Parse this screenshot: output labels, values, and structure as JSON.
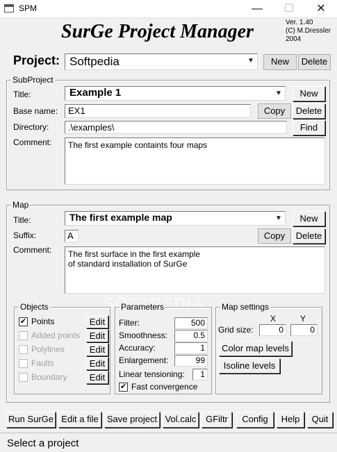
{
  "window": {
    "title": "SPM",
    "minimize": "—",
    "maximize": "☐",
    "close": "✕"
  },
  "header": {
    "app_title": "SurGe Project Manager",
    "version_lines": [
      "Ver. 1.40",
      "(C) M.Dressler",
      "2004"
    ]
  },
  "project": {
    "label": "Project:",
    "value": "Softpedia",
    "new_label": "New",
    "delete_label": "Delete"
  },
  "subproject": {
    "group_title": "SubProject",
    "title_label": "Title:",
    "title_value": "Example 1",
    "base_name_label": "Base name:",
    "base_name_value": "EX1",
    "directory_label": "Directory:",
    "directory_value": ".\\examples\\",
    "comment_label": "Comment:",
    "comment_value": "The first example containts four maps",
    "new_label": "New",
    "copy_label": "Copy",
    "delete_label": "Delete",
    "find_label": "Find"
  },
  "map": {
    "group_title": "Map",
    "title_label": "Title:",
    "title_value": "The first example map",
    "suffix_label": "Suffix:",
    "suffix_value": "A",
    "comment_label": "Comment:",
    "comment_lines": [
      "The first surface in the first example",
      "of standard installation of SurGe"
    ],
    "new_label": "New",
    "copy_label": "Copy",
    "delete_label": "Delete"
  },
  "objects": {
    "group_title": "Objects",
    "edit_label": "Edit",
    "items": [
      {
        "label": "Points",
        "checked": true,
        "enabled": true
      },
      {
        "label": "Added points",
        "checked": false,
        "enabled": false
      },
      {
        "label": "Polylines",
        "checked": false,
        "enabled": false
      },
      {
        "label": "Faults",
        "checked": false,
        "enabled": false
      },
      {
        "label": "Boundary",
        "checked": false,
        "enabled": false
      }
    ]
  },
  "parameters": {
    "group_title": "Parameters",
    "filter_label": "Filter:",
    "filter_value": "500",
    "smoothness_label": "Smoothness:",
    "smoothness_value": "0.5",
    "accuracy_label": "Accuracy:",
    "accuracy_value": "1",
    "enlargement_label": "Enlargement:",
    "enlargement_value": "99",
    "linear_label": "Linear tensioning:",
    "linear_value": "1",
    "fast_label": "Fast convergence",
    "fast_checked": true
  },
  "map_settings": {
    "group_title": "Map settings",
    "x_label": "X",
    "y_label": "Y",
    "grid_label": "Grid size:",
    "grid_x": "0",
    "grid_y": "0",
    "color_levels_label": "Color map levels",
    "isoline_levels_label": "Isoline levels"
  },
  "toolbar": {
    "run_surge": "Run SurGe",
    "edit_file": "Edit a file",
    "save_project": "Save project",
    "vol_calc": "Vol.calc",
    "gfiltr": "GFiltr",
    "config": "Config",
    "help": "Help",
    "quit": "Quit"
  },
  "status": {
    "text": "Select a project"
  },
  "watermark": {
    "text": "SOFTPEDIA"
  },
  "check_mark": "✔"
}
